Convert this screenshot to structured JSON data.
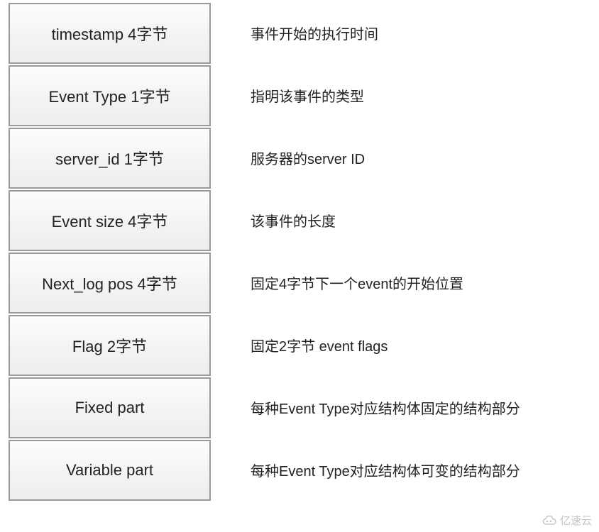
{
  "rows": [
    {
      "field": "timestamp 4字节",
      "desc": "事件开始的执行时间"
    },
    {
      "field": "Event Type 1字节",
      "desc": "指明该事件的类型"
    },
    {
      "field": "server_id 1字节",
      "desc": "服务器的server ID"
    },
    {
      "field": "Event size  4字节",
      "desc": "该事件的长度"
    },
    {
      "field": "Next_log pos 4字节",
      "desc": "固定4字节下一个event的开始位置"
    },
    {
      "field": "Flag 2字节",
      "desc": "固定2字节 event flags"
    },
    {
      "field": "Fixed part",
      "desc": "每种Event Type对应结构体固定的结构部分"
    },
    {
      "field": "Variable part",
      "desc": "每种Event Type对应结构体可变的结构部分"
    }
  ],
  "watermark": "亿速云"
}
